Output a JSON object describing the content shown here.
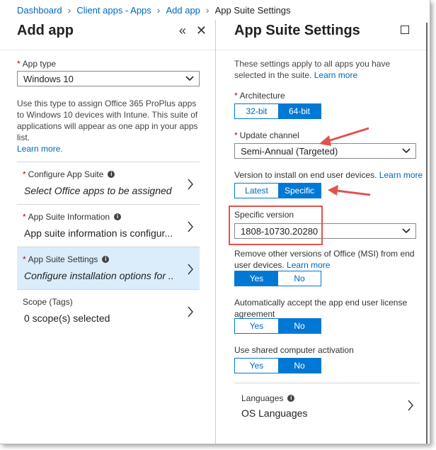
{
  "breadcrumb": {
    "items": [
      "Dashboard",
      "Client apps - Apps",
      "Add app"
    ],
    "current": "App Suite Settings"
  },
  "left_pane": {
    "title": "Add app",
    "app_type": {
      "label": "App type",
      "value": "Windows 10"
    },
    "description": "Use this type to assign Office 365 ProPlus apps to Windows 10 devices with Intune. This suite of applications will appear as one app in your apps list.",
    "learn_more": "Learn more.",
    "nav": [
      {
        "label": "Configure App Suite",
        "value": "Select Office apps to be assigned",
        "required": true
      },
      {
        "label": "App Suite Information",
        "value": "App suite information is configur...",
        "required": true
      },
      {
        "label": "App Suite Settings",
        "value": "Configure installation options for ...",
        "required": true
      },
      {
        "label": "Scope (Tags)",
        "value": "0 scope(s) selected",
        "required": false
      }
    ]
  },
  "right_pane": {
    "title": "App Suite Settings",
    "intro": "These settings apply to all apps you have selected in the suite.",
    "intro_link": "Learn more",
    "architecture": {
      "label": "Architecture",
      "options": [
        "32-bit",
        "64-bit"
      ],
      "selected": "64-bit"
    },
    "update_channel": {
      "label": "Update channel",
      "value": "Semi-Annual (Targeted)"
    },
    "version_install": {
      "label": "Version to install on end user devices.",
      "link": "Learn more",
      "options": [
        "Latest",
        "Specific"
      ],
      "selected": "Specific"
    },
    "specific_version": {
      "label": "Specific version",
      "value": "1808-10730.20280"
    },
    "remove_msi": {
      "label": "Remove other versions of Office (MSI) from end user devices.",
      "link": "Learn more",
      "options": [
        "Yes",
        "No"
      ],
      "selected": "Yes"
    },
    "accept_license": {
      "label": "Automatically accept the app end user license agreement",
      "options": [
        "Yes",
        "No"
      ],
      "selected": "No"
    },
    "shared_activation": {
      "label": "Use shared computer activation",
      "options": [
        "Yes",
        "No"
      ],
      "selected": "No"
    },
    "languages": {
      "label": "Languages",
      "value": "OS Languages"
    }
  },
  "colors": {
    "accent": "#0078d4",
    "link": "#0067b8",
    "selected_row": "#dbedfb",
    "annotation": "#e0544e"
  },
  "icons": [
    "chevron-right-icon",
    "collapse-icon",
    "close-icon",
    "maximize-icon",
    "chevron-down-icon",
    "info-icon"
  ]
}
